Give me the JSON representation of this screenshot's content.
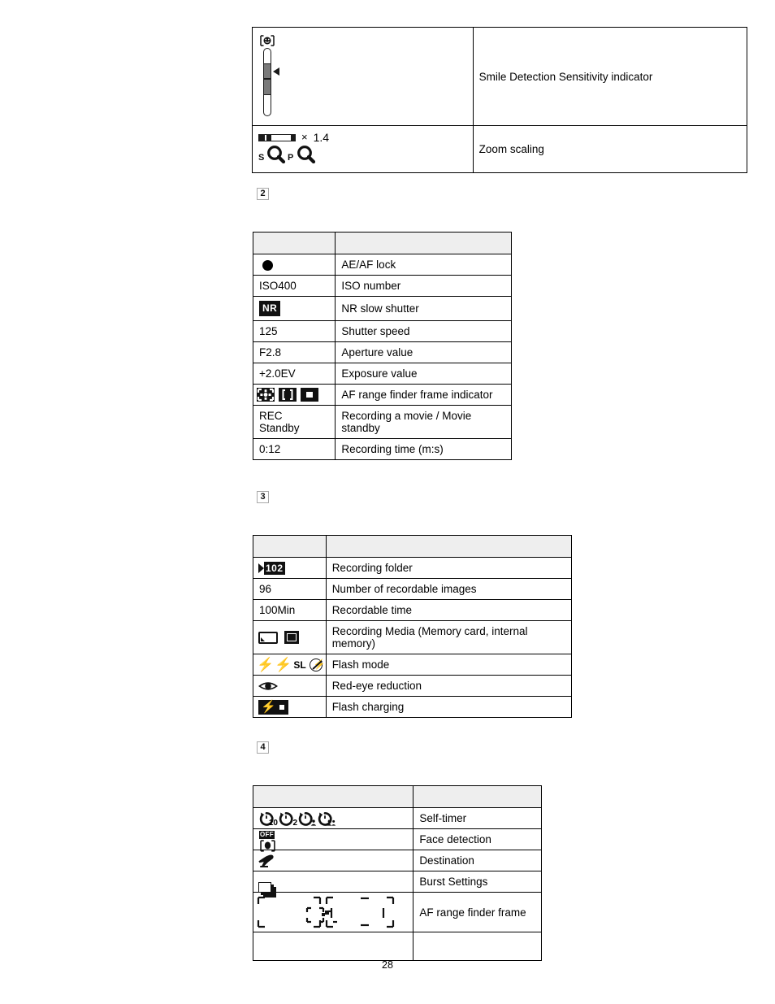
{
  "page": {
    "number": "28"
  },
  "sections": [
    {
      "badge": "2"
    },
    {
      "badge": "3"
    },
    {
      "badge": "4"
    }
  ],
  "table1": {
    "rows": [
      {
        "icon": "smile-detection-sensitivity-gauge-icon",
        "label": "Smile Detection Sensitivity indicator"
      },
      {
        "icon": "zoom-scaling-icon",
        "zoom_multiplier_symbol": "×",
        "zoom_multiplier_value": "1.4",
        "zoom_modes": "sQ pQ",
        "label": "Zoom scaling"
      }
    ]
  },
  "table2": {
    "header": {
      "col1": "",
      "col2": ""
    },
    "rows": [
      {
        "symbol": "",
        "icon": "ae-af-lock-dot-icon",
        "label": "AE/AF lock"
      },
      {
        "symbol": "ISO400",
        "icon": "",
        "label": "ISO number"
      },
      {
        "symbol": "NR",
        "icon": "nr-slow-shutter-icon",
        "label": "NR slow shutter"
      },
      {
        "symbol": "125",
        "icon": "",
        "label": "Shutter speed"
      },
      {
        "symbol": "F2.8",
        "icon": "",
        "label": "Aperture value"
      },
      {
        "symbol": "+2.0EV",
        "icon": "",
        "label": "Exposure value"
      },
      {
        "symbol": "",
        "icon": "af-range-finder-frame-indicator-icons",
        "label": "AF range finder frame indicator"
      },
      {
        "symbol": "REC\nStandby",
        "icon": "",
        "label": "Recording a movie / Movie standby"
      },
      {
        "symbol": "0:12",
        "icon": "",
        "label": "Recording time (m:s)"
      }
    ]
  },
  "table3": {
    "header": {
      "col1": "",
      "col2": ""
    },
    "rows": [
      {
        "symbol": "102",
        "icon": "recording-folder-icon",
        "label": "Recording folder"
      },
      {
        "symbol": "96",
        "icon": "",
        "label": "Number of recordable images"
      },
      {
        "symbol": "100Min",
        "icon": "",
        "label": "Recordable time"
      },
      {
        "symbol": "",
        "icon": "recording-media-icons",
        "label": "Recording Media (Memory card, internal memory)"
      },
      {
        "symbol": "SL",
        "icon": "flash-mode-icons",
        "label": "Flash mode"
      },
      {
        "symbol": "",
        "icon": "red-eye-reduction-icon",
        "label": "Red-eye reduction"
      },
      {
        "symbol": "",
        "icon": "flash-charging-icon",
        "label": "Flash charging"
      }
    ]
  },
  "table4": {
    "header": {
      "col1": "",
      "col2": ""
    },
    "rows": [
      {
        "icon": "self-timer-icons",
        "sub1": "10",
        "sub2": "2",
        "label": "Self-timer"
      },
      {
        "icon": "face-detection-off-icon",
        "off_text": "OFF",
        "label": "Face detection"
      },
      {
        "icon": "destination-airplane-icon",
        "label": "Destination"
      },
      {
        "icon": "burst-settings-icon",
        "label": "Burst Settings"
      },
      {
        "icon": "af-range-finder-frame-icon",
        "label": "AF range finder frame"
      },
      {
        "icon": "",
        "label": ""
      }
    ]
  },
  "colors": {
    "header_fill": "#eeeeee",
    "border": "#000000",
    "ink": "#111111",
    "badge_border": "#a9a9a9"
  }
}
